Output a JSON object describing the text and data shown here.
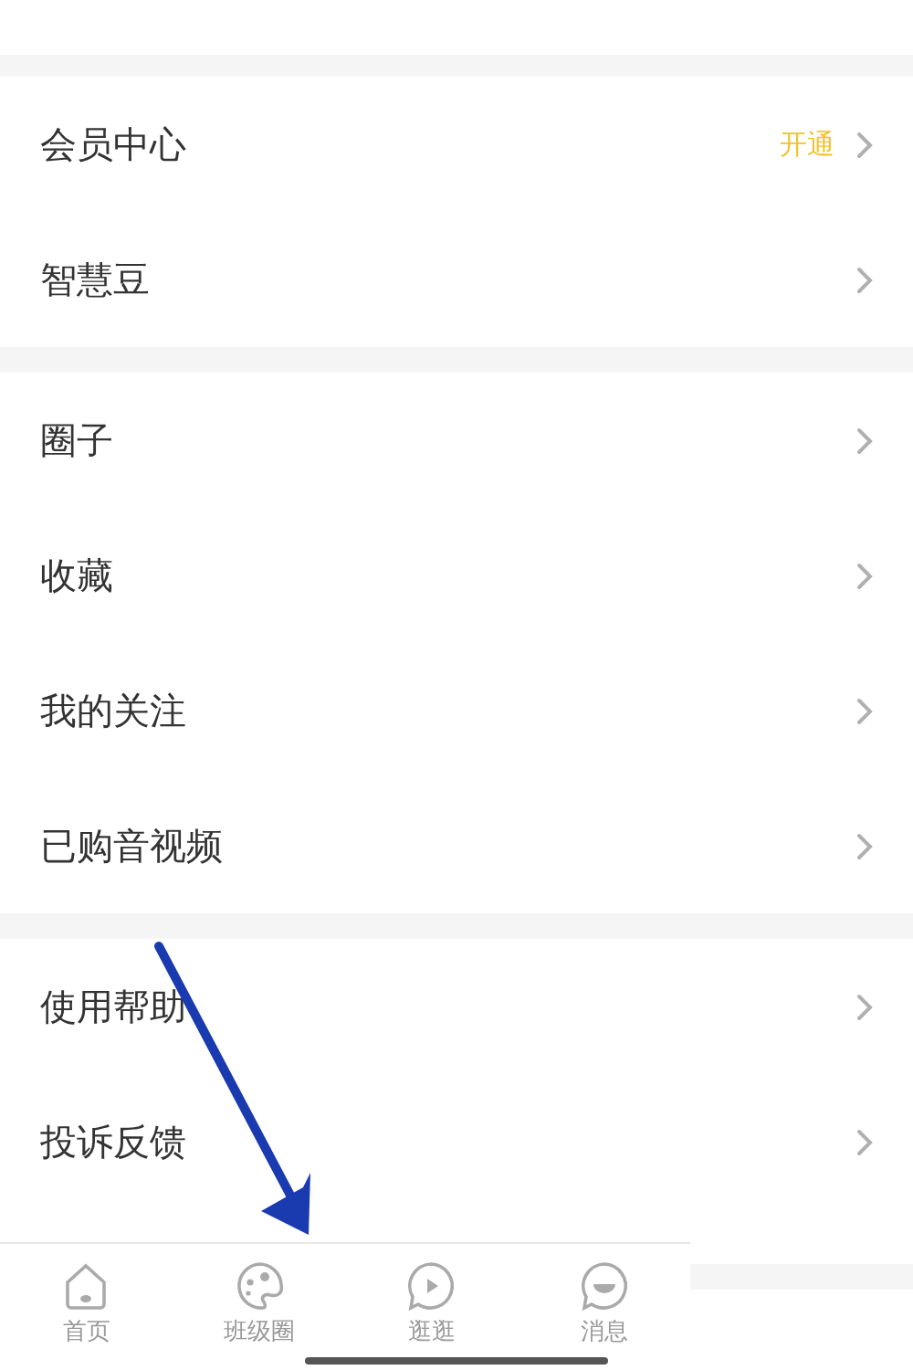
{
  "sections": [
    {
      "rows": [
        {
          "label": "会员中心",
          "badge": "开通"
        },
        {
          "label": "智慧豆"
        }
      ]
    },
    {
      "rows": [
        {
          "label": "圈子"
        },
        {
          "label": "收藏"
        },
        {
          "label": "我的关注"
        },
        {
          "label": "已购音视频"
        }
      ]
    },
    {
      "rows": [
        {
          "label": "使用帮助"
        },
        {
          "label": "投诉反馈"
        }
      ]
    }
  ],
  "tab_bar": [
    {
      "label": "首页",
      "kind": "home",
      "selected": false
    },
    {
      "label": "班级圈",
      "kind": "palette",
      "selected": false
    },
    {
      "label": "逛逛",
      "kind": "play",
      "selected": false
    },
    {
      "label": "消息",
      "kind": "chat",
      "selected": false
    }
  ]
}
